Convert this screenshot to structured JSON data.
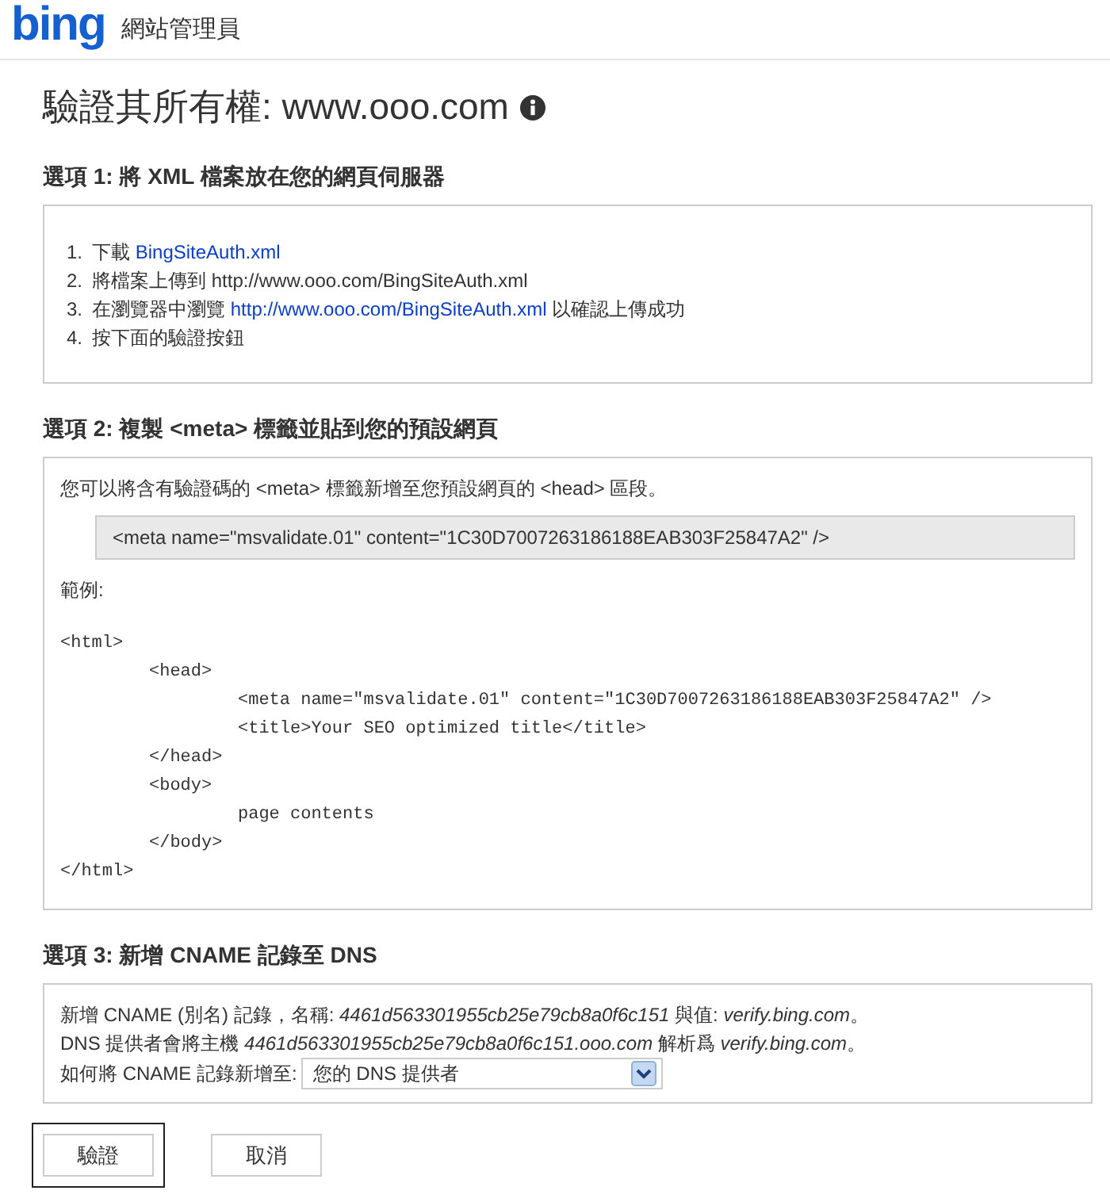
{
  "header": {
    "logo": "bing",
    "title": "網站管理員"
  },
  "heading": "驗證其所有權: www.ooo.com",
  "option1": {
    "title": "選項 1: 將 XML 檔案放在您的網頁伺服器",
    "steps": [
      {
        "number": "1.",
        "segments": [
          {
            "kind": "text",
            "text": "下載"
          },
          {
            "kind": "link",
            "text": "BingSiteAuth.xml"
          }
        ]
      },
      {
        "number": "2.",
        "segments": [
          {
            "kind": "text",
            "text": "將檔案上傳到 http://www.ooo.com/BingSiteAuth.xml"
          }
        ]
      },
      {
        "number": "3.",
        "segments": [
          {
            "kind": "text",
            "text": "在瀏覽器中瀏覽"
          },
          {
            "kind": "link",
            "text": "http://www.ooo.com/BingSiteAuth.xml"
          },
          {
            "kind": "text",
            "text": "以確認上傳成功"
          }
        ]
      },
      {
        "number": "4.",
        "segments": [
          {
            "kind": "text",
            "text": "按下面的驗證按鈕"
          }
        ]
      }
    ]
  },
  "option2": {
    "title": "選項 2: 複製 <meta> 標籤並貼到您的預設網頁",
    "intro": "您可以將含有驗證碼的 <meta> 標籤新增至您預設網頁的 <head> 區段。",
    "meta_tag": "<meta name=\"msvalidate.01\" content=\"1C30D7007263186188EAB303F25847A2\" />",
    "example_label": "範例:",
    "code": [
      {
        "text": "<html>"
      },
      {
        "children": [
          {
            "text": "<head>"
          },
          {
            "children": [
              {
                "text": "<meta name=\"msvalidate.01\" content=\"1C30D7007263186188EAB303F25847A2\" />"
              },
              {
                "text": "<title>Your SEO optimized title</title>"
              }
            ]
          },
          {
            "text": "</head>"
          },
          {
            "text": "<body>"
          },
          {
            "children": [
              {
                "text": "page contents"
              }
            ]
          },
          {
            "text": "</body>"
          }
        ]
      },
      {
        "text": "</html>"
      }
    ]
  },
  "option3": {
    "title": "選項 3: 新增 CNAME 記錄至 DNS",
    "lines": [
      "新增 CNAME (別名) 記錄，名稱: *4461d563301955cb25e79cb8a0f6c151* 與值: *verify.bing.com*。",
      "DNS 提供者會將主機 *4461d563301955cb25e79cb8a0f6c151.ooo.com* 解析爲 *verify.bing.com*。"
    ],
    "provider_label": "如何將 CNAME 記錄新增至:",
    "provider_value": "您的 DNS 提供者"
  },
  "buttons": [
    {
      "label": "驗證",
      "highlighted": true
    },
    {
      "label": "取消",
      "highlighted": false
    }
  ]
}
